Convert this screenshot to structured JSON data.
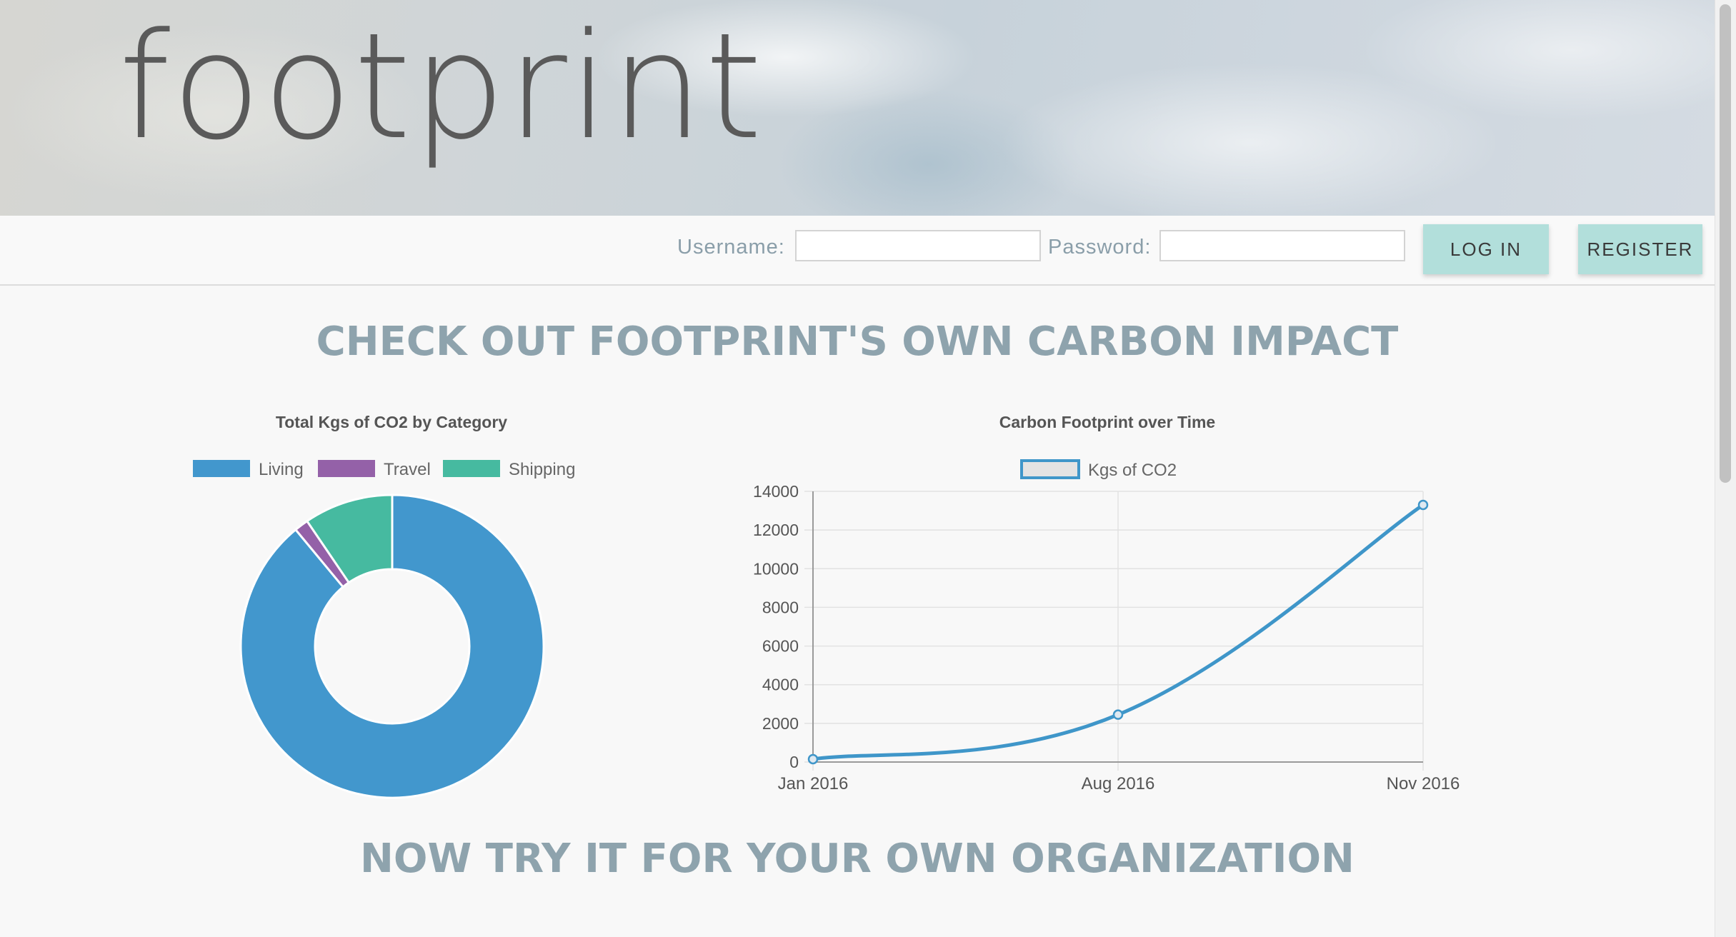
{
  "app": {
    "logo_text": "footprint"
  },
  "login": {
    "username_label": "Username:",
    "username_value": "",
    "password_label": "Password:",
    "password_value": "",
    "login_button": "LOG IN",
    "register_button": "REGISTER"
  },
  "main": {
    "heading": "CHECK OUT FOOTPRINT'S OWN CARBON IMPACT",
    "subheading": "NOW TRY IT FOR YOUR OWN ORGANIZATION"
  },
  "colors": {
    "living": "#4297cd",
    "travel": "#9461a8",
    "shipping": "#46baa0",
    "line": "#3f96c9",
    "button": "#b2dfdb",
    "heading": "#8ea3ad"
  },
  "chart_data": [
    {
      "type": "pie",
      "title": "Total Kgs of CO2 by Category",
      "donut": true,
      "legend_position": "top",
      "categories": [
        "Living",
        "Travel",
        "Shipping"
      ],
      "values": [
        89,
        1.5,
        9.5
      ]
    },
    {
      "type": "line",
      "title": "Carbon Footprint over Time",
      "legend_position": "top",
      "categories": [
        "Jan 2016",
        "Aug 2016",
        "Nov 2016"
      ],
      "series": [
        {
          "name": "Kgs of CO2",
          "values": [
            150,
            2450,
            13300
          ]
        }
      ],
      "ylim": [
        0,
        14000
      ],
      "yticks": [
        0,
        2000,
        4000,
        6000,
        8000,
        10000,
        12000,
        14000
      ],
      "grid": true
    }
  ]
}
